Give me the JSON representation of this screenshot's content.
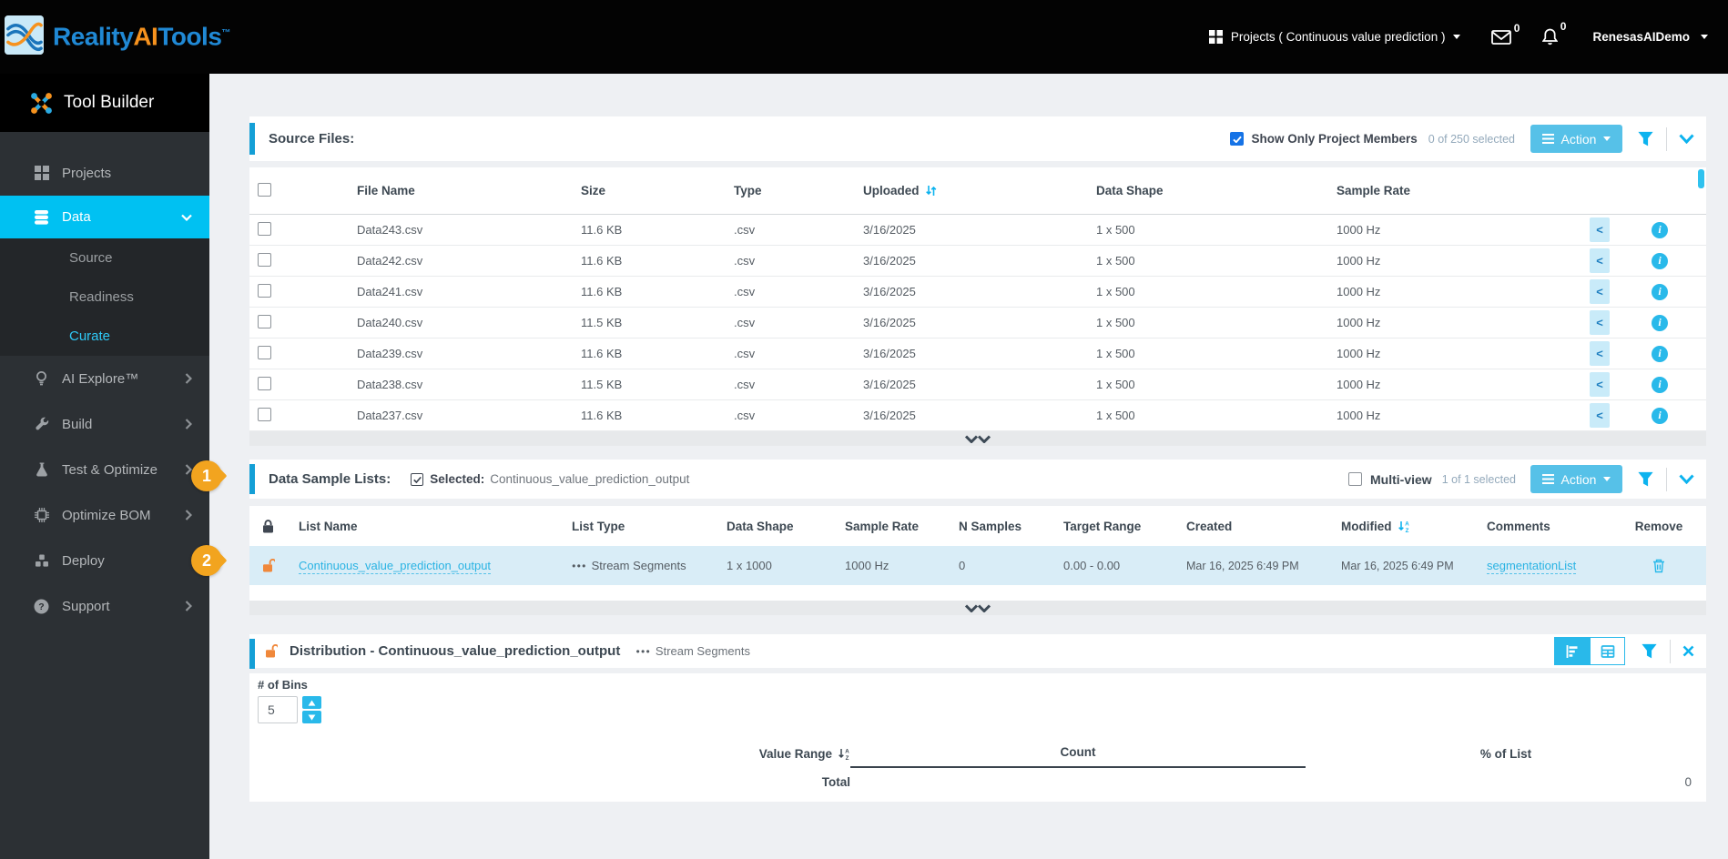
{
  "topbar": {
    "brand": {
      "word1": "Reality",
      "word2": "AI",
      "word3": "Tools",
      "tm": "™"
    },
    "projects_menu": "Projects ( Continuous value prediction )",
    "mail_count": "0",
    "notif_count": "0",
    "user": "RenesasAIDemo"
  },
  "sidebar": {
    "title": "Tool Builder",
    "items": [
      {
        "label": "Projects"
      },
      {
        "label": "Data"
      },
      {
        "label": "AI Explore™"
      },
      {
        "label": "Build"
      },
      {
        "label": "Test & Optimize"
      },
      {
        "label": "Optimize BOM"
      },
      {
        "label": "Deploy"
      },
      {
        "label": "Support"
      }
    ],
    "data_subitems": [
      {
        "label": "Source"
      },
      {
        "label": "Readiness"
      },
      {
        "label": "Curate"
      }
    ]
  },
  "annotations": {
    "marker1": "1",
    "marker2": "2"
  },
  "source_files": {
    "title": "Source Files:",
    "show_only_label": "Show Only Project Members",
    "selection_status": "0 of 250 selected",
    "action_label": "Action",
    "columns": [
      "File Name",
      "Size",
      "Type",
      "Uploaded",
      "Data Shape",
      "Sample Rate"
    ],
    "rows": [
      {
        "file": "Data243.csv",
        "size": "11.6 KB",
        "type": ".csv",
        "uploaded": "3/16/2025",
        "shape": "1 x 500",
        "rate": "1000 Hz"
      },
      {
        "file": "Data242.csv",
        "size": "11.6 KB",
        "type": ".csv",
        "uploaded": "3/16/2025",
        "shape": "1 x 500",
        "rate": "1000 Hz"
      },
      {
        "file": "Data241.csv",
        "size": "11.6 KB",
        "type": ".csv",
        "uploaded": "3/16/2025",
        "shape": "1 x 500",
        "rate": "1000 Hz"
      },
      {
        "file": "Data240.csv",
        "size": "11.5 KB",
        "type": ".csv",
        "uploaded": "3/16/2025",
        "shape": "1 x 500",
        "rate": "1000 Hz"
      },
      {
        "file": "Data239.csv",
        "size": "11.6 KB",
        "type": ".csv",
        "uploaded": "3/16/2025",
        "shape": "1 x 500",
        "rate": "1000 Hz"
      },
      {
        "file": "Data238.csv",
        "size": "11.5 KB",
        "type": ".csv",
        "uploaded": "3/16/2025",
        "shape": "1 x 500",
        "rate": "1000 Hz"
      },
      {
        "file": "Data237.csv",
        "size": "11.6 KB",
        "type": ".csv",
        "uploaded": "3/16/2025",
        "shape": "1 x 500",
        "rate": "1000 Hz"
      }
    ]
  },
  "sample_lists": {
    "title": "Data Sample Lists:",
    "selected_label": "Selected:",
    "selected_value": "Continuous_value_prediction_output",
    "multiview_label": "Multi-view",
    "selection_status": "1 of 1 selected",
    "action_label": "Action",
    "columns": [
      "List Name",
      "List Type",
      "Data Shape",
      "Sample Rate",
      "N Samples",
      "Target Range",
      "Created",
      "Modified",
      "Comments",
      "Remove"
    ],
    "row": {
      "name": "Continuous_value_prediction_output",
      "type": "Stream Segments",
      "shape": "1 x 1000",
      "rate": "1000 Hz",
      "n_samples": "0",
      "target_range": "0.00 - 0.00",
      "created": "Mar 16, 2025 6:49 PM",
      "modified": "Mar 16, 2025 6:49 PM",
      "comment": "segmentationList"
    }
  },
  "distribution": {
    "title": "Distribution - Continuous_value_prediction_output",
    "list_type": "Stream Segments",
    "bins_label": "# of Bins",
    "bins_value": "5",
    "columns": [
      "Value Range",
      "Count",
      "% of List"
    ],
    "total_label": "Total",
    "total_value": "0"
  },
  "colors": {
    "accent_bar": "#149fd6",
    "cyan_icon": "#0cb3ef",
    "sidebar_active": "#00c1f2",
    "action_button": "#56c1e8",
    "selected_row": "#d9edf7",
    "annotation_marker": "#f2a41f",
    "link": "#2ab3e3",
    "open_lock_orange": "#f0883b"
  }
}
